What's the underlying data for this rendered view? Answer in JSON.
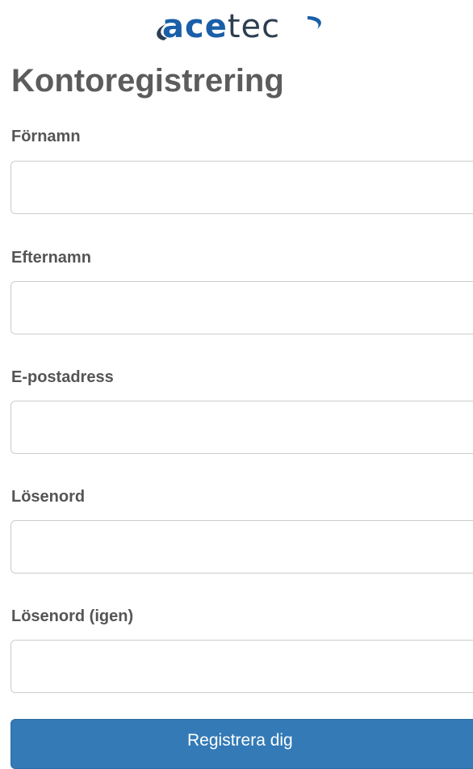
{
  "brand": {
    "logo_text": "acetec",
    "logo_part1": "ace",
    "logo_part2": "tec",
    "color_primary": "#1a5fa8",
    "color_dark": "#2d3e50"
  },
  "form": {
    "title": "Kontoregistrering",
    "fields": [
      {
        "label": "Förnamn",
        "value": "",
        "placeholder": ""
      },
      {
        "label": "Efternamn",
        "value": "",
        "placeholder": ""
      },
      {
        "label": "E-postadress",
        "value": "",
        "placeholder": ""
      },
      {
        "label": "Lösenord",
        "value": "",
        "placeholder": ""
      },
      {
        "label": "Lösenord (igen)",
        "value": "",
        "placeholder": ""
      }
    ],
    "submit_label": "Registrera dig",
    "submit_color": "#337ab7"
  }
}
